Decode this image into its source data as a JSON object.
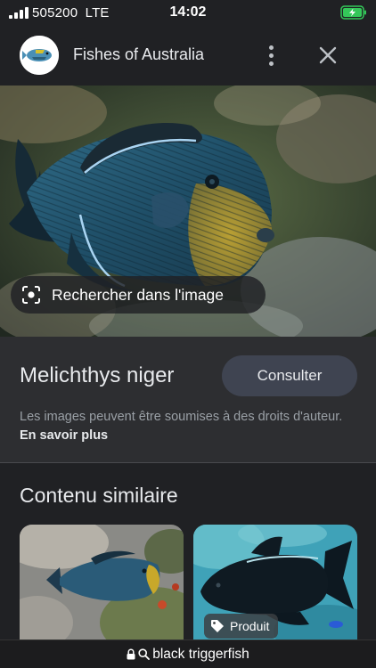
{
  "status_bar": {
    "carrier": "505200",
    "network": "LTE",
    "time": "14:02"
  },
  "header": {
    "site_title": "Fishes of Australia"
  },
  "image_overlay": {
    "lens_label": "Rechercher dans l'image"
  },
  "info": {
    "species_name": "Melichthys niger",
    "visit_label": "Consulter",
    "copyright_text": "Les images peuvent être soumises à des droits d'auteur.",
    "learn_more": "En savoir plus"
  },
  "similar": {
    "title": "Contenu similaire",
    "product_badge": "Produit"
  },
  "url_bar": {
    "text": "black triggerfish"
  },
  "colors": {
    "background": "#202124",
    "panel": "#2d2e31",
    "button": "#3f4451",
    "muted_text": "#9aa0a6",
    "battery": "#34c759"
  },
  "icons": [
    "signal-icon",
    "battery-charging-icon",
    "site-logo",
    "more-vert-icon",
    "close-icon",
    "lens-icon",
    "tag-icon",
    "lock-icon",
    "search-icon"
  ]
}
